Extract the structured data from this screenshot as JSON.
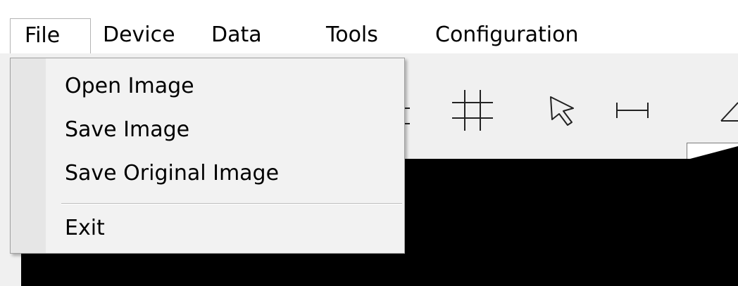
{
  "menubar": {
    "items": [
      {
        "label": "File"
      },
      {
        "label": "Device"
      },
      {
        "label": "Data"
      },
      {
        "label": "Tools"
      },
      {
        "label": "Configuration"
      }
    ],
    "open_menu": "File"
  },
  "file_menu": {
    "items": [
      {
        "label": "Open Image"
      },
      {
        "label": "Save Image"
      },
      {
        "label": "Save Original Image"
      },
      {
        "label": "Exit"
      }
    ]
  },
  "toolbar": {
    "icons": [
      "crop-icon",
      "grid-icon",
      "pointer-icon",
      "measure-distance-icon",
      "measure-angle-icon"
    ]
  },
  "colors": {
    "menu_background": "#f2f2f2",
    "menu_gutter": "#e6e6e6",
    "menubar_background": "#ffffff",
    "canvas": "#000000",
    "toolbar_background": "#f0f0f0"
  }
}
